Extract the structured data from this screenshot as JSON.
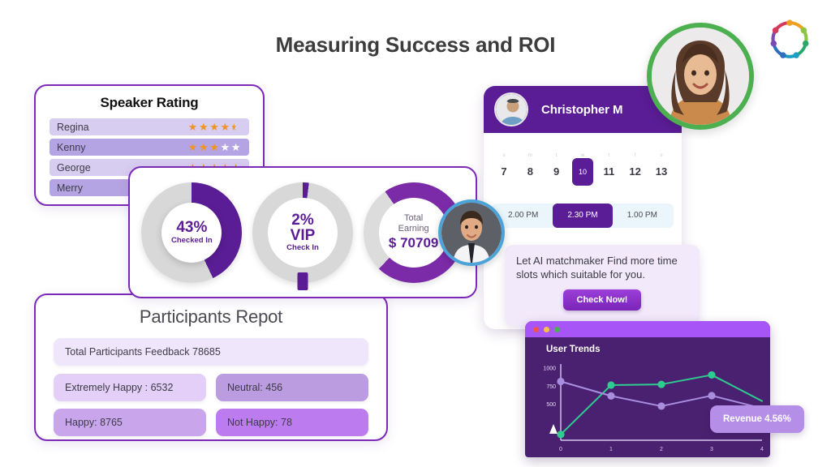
{
  "page": {
    "title": "Measuring Success and ROI",
    "logo_icon": "people-circle-logo-icon"
  },
  "speaker_rating": {
    "title": "Speaker Rating",
    "rows": [
      {
        "name": "Regina",
        "stars": 4.5
      },
      {
        "name": "Kenny",
        "stars": 3
      },
      {
        "name": "George",
        "stars": 5
      },
      {
        "name": "Merry",
        "stars": 0
      }
    ],
    "star_on_color": "#f09520",
    "star_off_color": "#ffffff"
  },
  "donuts": [
    {
      "id": "checked-in",
      "value_label": "43%",
      "sub_label": "Checked In",
      "percent": 43,
      "fill_color": "#5b1d96",
      "track_color": "#d8d8d8"
    },
    {
      "id": "vip-check-in",
      "value_label": "2%",
      "value_label_2": "VIP",
      "sub_label": "Check In",
      "percent": 2,
      "fill_color": "#5b1d96",
      "track_color": "#d8d8d8"
    },
    {
      "id": "total-earning",
      "label_line1": "Total",
      "label_line2": "Earning",
      "amount": "$ 70709",
      "percent": 72,
      "fill_color": "#7b2ba8",
      "track_color": "#dcdcdc"
    }
  ],
  "participants_report": {
    "title": "Participants Repot",
    "total_label": "Total Participants Feedback  78685",
    "cells": [
      {
        "label": "Extremely Happy : 6532",
        "color": "#e3cff7"
      },
      {
        "label": "Neutral: 456",
        "color": "#bc9ce0"
      },
      {
        "label": "Happy: 8765",
        "color": "#c9a6ec"
      },
      {
        "label": "Not Happy: 78",
        "color": "#bd7bf0"
      }
    ]
  },
  "booking": {
    "person_name": "Christopher M",
    "avatar_icon": "person-avatar-icon",
    "day_initials": [
      "s",
      "m",
      "t",
      "w",
      "t",
      "f",
      "s"
    ],
    "days": [
      "7",
      "8",
      "9",
      "10",
      "11",
      "12",
      "13"
    ],
    "selected_day": "10",
    "slots": [
      "2.00 PM",
      "2.30 PM",
      "1.00 PM"
    ],
    "selected_slot": "2.30 PM"
  },
  "ai_promo": {
    "text": "Let AI matchmaker Find more time slots which suitable for you.",
    "button_label": "Check Now!"
  },
  "avatars": {
    "woman_ring_color": "#4caf50",
    "man_ring_color": "#4ba3d8"
  },
  "trends_window": {
    "title": "User Trends",
    "traffic_lights": [
      "#ef5350",
      "#f5c242",
      "#4caf50"
    ],
    "badge_label": "Revenue 4.56%"
  },
  "chart_data": {
    "type": "line",
    "title": "User Trends",
    "x": [
      0,
      1,
      2,
      3,
      4
    ],
    "xlabel": "",
    "ylabel": "",
    "xlim": [
      0,
      4
    ],
    "ylim": [
      0,
      1050
    ],
    "yticks": [
      500,
      750,
      1000
    ],
    "ytick_labels": [
      "500",
      "750",
      "1000"
    ],
    "xtick_labels": [
      "0",
      "1",
      "2",
      "3",
      "4"
    ],
    "grid": false,
    "legend": "none",
    "annotations": [
      "Revenue 4.56%"
    ],
    "series": [
      {
        "name": "green-series",
        "color": "#2ecc8f",
        "values": [
          80,
          760,
          770,
          900,
          540
        ]
      },
      {
        "name": "purple-series",
        "color": "#a98ee0",
        "values": [
          810,
          610,
          470,
          615,
          440
        ]
      }
    ]
  }
}
